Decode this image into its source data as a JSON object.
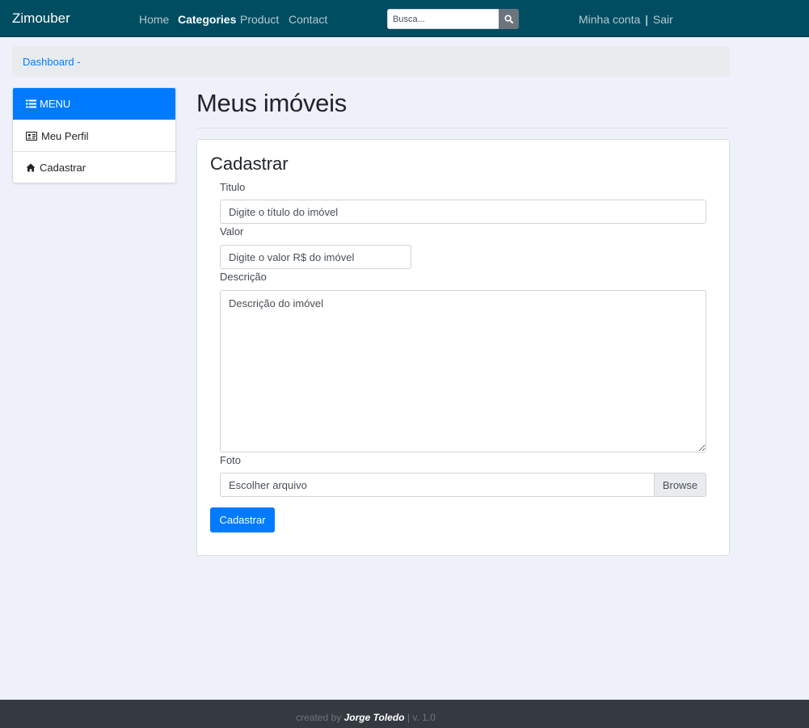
{
  "navbar": {
    "brand": "Zimouber",
    "links": [
      {
        "label": "Home"
      },
      {
        "label": "Categories"
      },
      {
        "label": "Product"
      },
      {
        "label": "Contact"
      }
    ],
    "search_placeholder": "Busca...",
    "search_icon": "search-icon",
    "account": "Minha conta",
    "separator": "|",
    "logout": "Sair"
  },
  "breadcrumb": {
    "item": "Dashboard -"
  },
  "sidebar": {
    "header": "MENU",
    "header_icon": "list-icon",
    "items": [
      {
        "label": "Meu Perfil",
        "icon": "id-card-icon"
      },
      {
        "label": "Cadastrar",
        "icon": "home-icon"
      }
    ]
  },
  "main": {
    "title": "Meus imóveis",
    "card_title": "Cadastrar",
    "form": {
      "titulo_label": "Titulo",
      "titulo_placeholder": "Digite o título do imóvel",
      "valor_label": "Valor",
      "valor_placeholder": "Digite o valor R$ do imóvel",
      "descricao_label": "Descrição",
      "descricao_placeholder": "Descrição do imóvel",
      "foto_label": "Foto",
      "file_label": "Escolher arquivo",
      "browse_label": "Browse",
      "submit_label": "Cadastrar"
    }
  },
  "footer": {
    "prefix": "created by ",
    "author": "Jorge Toledo",
    "suffix": " | v. 1.0"
  },
  "colors": {
    "navbar": "#004d61",
    "primary": "#007bff",
    "background": "#eef1f9",
    "footer": "#343a40"
  }
}
